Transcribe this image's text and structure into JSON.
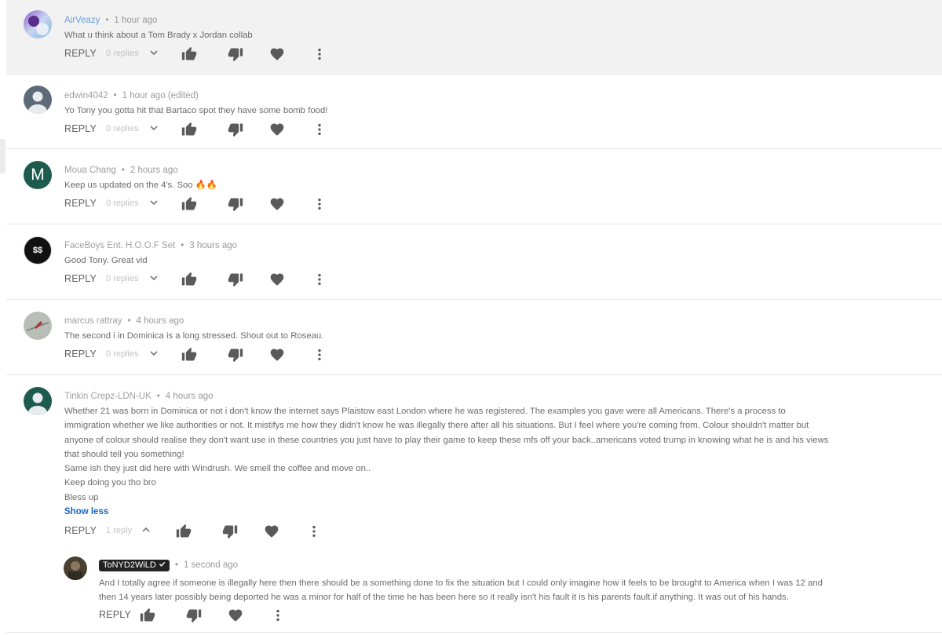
{
  "comments": [
    {
      "author": "AirVeazy",
      "time": "1 hour ago",
      "text": [
        "What u think about a Tom Brady x Jordan collab"
      ],
      "reply_label": "REPLY",
      "replies": "0 replies"
    },
    {
      "author": "edwin4042",
      "time": "1 hour ago (edited)",
      "text": [
        "Yo Tony you gotta hit that Bartaco spot they have some bomb food!"
      ],
      "reply_label": "REPLY",
      "replies": "0 replies"
    },
    {
      "author": "Moua Chang",
      "avatar_letter": "M",
      "time": "2 hours ago",
      "text": [
        "Keep us updated on the 4's.  Soo 🔥🔥"
      ],
      "reply_label": "REPLY",
      "replies": "0 replies"
    },
    {
      "author": "FaceBoys Ent. H.O.O.F Set",
      "avatar_text": "$$",
      "time": "3 hours ago",
      "text": [
        "Good Tony. Great vid"
      ],
      "reply_label": "REPLY",
      "replies": "0 replies"
    },
    {
      "author": "marcus rattray",
      "time": "4 hours ago",
      "text": [
        "The second i in Dominica is a long stressed. Shout out to Roseau."
      ],
      "reply_label": "REPLY",
      "replies": "0 replies"
    },
    {
      "author": "Tinkin Crepz-LDN-UK",
      "time": "4 hours ago",
      "text": [
        "Whether 21 was born in Dominica or not i don't know the internet says Plaistow east London where he was registered. The examples you gave were all Americans. There's a process to",
        "immigration whether we like authorities or not. It mistifys me how they didn't know he was illegally there after all his situations. But I feel where you're coming from. Colour shouldn't matter but",
        "anyone of colour should realise they don't want use in these countries you just have to play their game to keep these mfs off your back..americans voted trump in knowing what he is and his views",
        "that should tell you something!",
        "Same ish they just did here with Windrush. We smell the coffee and move on..",
        "Keep doing you tho bro",
        "Bless up"
      ],
      "show_less": "Show less",
      "reply_label": "REPLY",
      "replies": "1 reply"
    }
  ],
  "nested_reply": {
    "author": "ToNYD2WiLD",
    "verified_icon": "check-icon",
    "time": "1 second ago",
    "text": [
      "And I totally agree if someone is illegally here then there should be a something done to fix the situation but I could only imagine how it feels to be brought to America when I was 12 and",
      "then 14 years later possibly being deported he was a minor for half of the time he has been here so it really isn't his fault it is his parents fault.if anything. It was out of his hands."
    ],
    "reply_label": "REPLY"
  },
  "icons": [
    "thumb-up-icon",
    "thumb-down-icon",
    "heart-icon",
    "more-vert-icon",
    "chevron-down-icon",
    "chevron-up-icon"
  ],
  "colors": {
    "author_link": "#6aa0d8",
    "show_less": "#1565c0",
    "highlight_bg": "#f2f2f2",
    "icon": "#5a5a5a"
  }
}
